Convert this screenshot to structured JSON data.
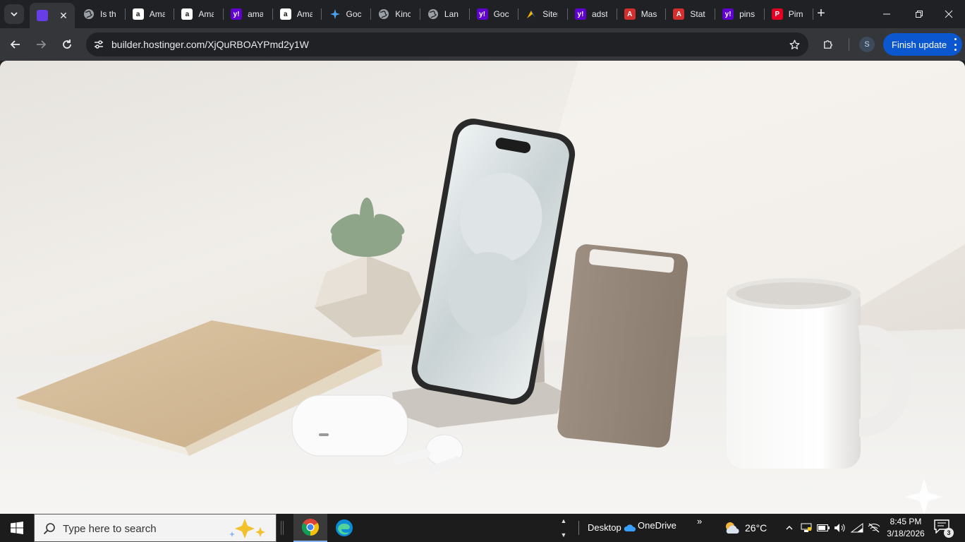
{
  "browser": {
    "tabs": [
      {
        "title": "Is th",
        "favicon": "globe-icon"
      },
      {
        "title": "Ama",
        "favicon": "amazon-icon"
      },
      {
        "title": "Ama",
        "favicon": "amazon-icon"
      },
      {
        "title": "ama",
        "favicon": "yahoo-icon"
      },
      {
        "title": "Ama",
        "favicon": "amazon-icon"
      },
      {
        "title": "Goc",
        "favicon": "gemini-icon"
      },
      {
        "title": "Kinc",
        "favicon": "globe-icon"
      },
      {
        "title": "Lan",
        "favicon": "globe-icon"
      },
      {
        "title": "Goc",
        "favicon": "yahoo-icon"
      },
      {
        "title": "Siter",
        "favicon": "sitelinks-icon"
      },
      {
        "title": "adst",
        "favicon": "yahoo-icon"
      },
      {
        "title": "Mas",
        "favicon": "acrobat-icon"
      },
      {
        "title": "Stat",
        "favicon": "acrobat-icon"
      },
      {
        "title": "pins",
        "favicon": "yahoo-icon"
      },
      {
        "title": "Pim",
        "favicon": "pinterest-icon"
      }
    ],
    "address": "builder.hostinger.com/XjQuRBOAYPmd2y1W",
    "profile_initial": "S",
    "finish_update_label": "Finish update",
    "accent": "#0b57d0"
  },
  "taskbar": {
    "search_placeholder": "Type here to search",
    "desktop_label": "Desktop",
    "onedrive_label": "OneDrive",
    "more_label": "»",
    "temperature": "26°C",
    "time": "8:45 PM",
    "date": "3/18/2026",
    "notification_count": "3"
  }
}
